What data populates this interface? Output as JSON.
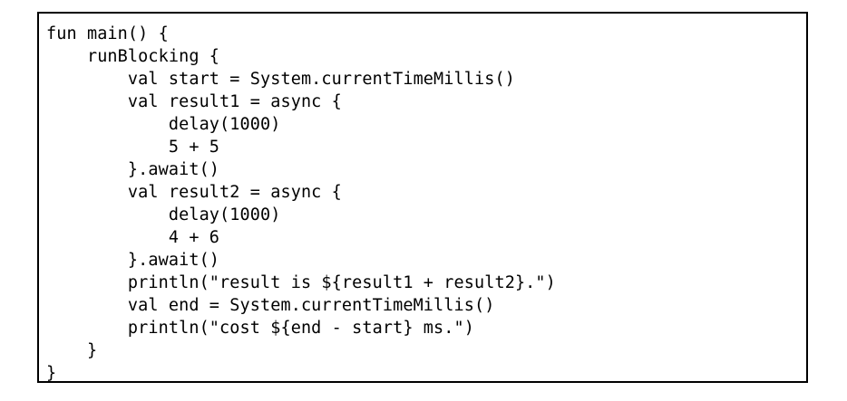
{
  "code": {
    "lines": [
      "fun main() {",
      "    runBlocking {",
      "        val start = System.currentTimeMillis()",
      "        val result1 = async {",
      "            delay(1000)",
      "            5 + 5",
      "        }.await()",
      "        val result2 = async {",
      "            delay(1000)",
      "            4 + 6",
      "        }.await()",
      "        println(\"result is ${result1 + result2}.\")",
      "        val end = System.currentTimeMillis()",
      "        println(\"cost ${end - start} ms.\")",
      "    }",
      "}"
    ]
  }
}
